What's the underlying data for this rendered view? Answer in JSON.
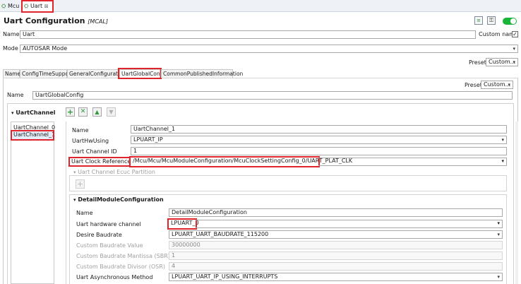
{
  "editor_tabs": [
    {
      "label": "Mcu"
    },
    {
      "label": "Uart",
      "close": "⊠"
    }
  ],
  "title": "Uart Configuration",
  "subtitle": "[MCAL]",
  "top_name": {
    "label": "Name",
    "value": "Uart"
  },
  "custom_name": {
    "label": "Custom name",
    "checked": true
  },
  "mode": {
    "label": "Mode",
    "value": "AUTOSAR Mode"
  },
  "preset": {
    "label": "Preset",
    "value": "Custom..."
  },
  "inner_tabs": [
    {
      "label": "Name"
    },
    {
      "label": "ConfigTimeSupport"
    },
    {
      "label": "GeneralConfiguration"
    },
    {
      "label": "UartGlobalConfig"
    },
    {
      "label": "CommonPublishedInformation"
    }
  ],
  "global": {
    "preset_label": "Preset",
    "preset_value": "Custom...",
    "name_label": "Name",
    "name_value": "UartGlobalConfig"
  },
  "channel_section": {
    "title": "UartChannel",
    "channels": [
      "UartChannel_0",
      "UartChannel_1"
    ]
  },
  "channel_form": {
    "name_label": "Name",
    "name_value": "UartChannel_1",
    "hw_label": "UartHwUsing",
    "hw_value": "LPUART_IP",
    "id_label": "Uart Channel ID",
    "id_value": "1",
    "clock_label": "Uart Clock Reference",
    "clock_value": "/Mcu/Mcu/McuModuleConfiguration/McuClockSettingConfig_0/UART_PLAT_CLK",
    "ecuc_label": "Uart Channel Ecuc Partition"
  },
  "detail": {
    "title": "DetailModuleConfiguration",
    "name_label": "Name",
    "name_value": "DetailModuleConfiguration",
    "hw_channel_label": "Uart hardware channel",
    "hw_channel_value": "LPUART_0",
    "baud_label": "Desire Baudrate",
    "baud_value": "LPUART_UART_BAUDRATE_115200",
    "custom_baud_label": "Custom Baudrate Value",
    "custom_baud_value": "30000000",
    "mantissa_label": "Custom Baudrate Mantissa (SBR)",
    "mantissa_value": "1",
    "divisor_label": "Custom Baudrate Divisor (OSR)",
    "divisor_value": "4",
    "async_label": "Uart Asynchronous Method",
    "async_value": "LPUART_UART_IP_USING_INTERRUPTS"
  },
  "colors": {
    "highlight": "#e0242b",
    "toggle_on": "#19b53a",
    "add": "#2d9a3c",
    "remove": "#2d9a3c"
  }
}
